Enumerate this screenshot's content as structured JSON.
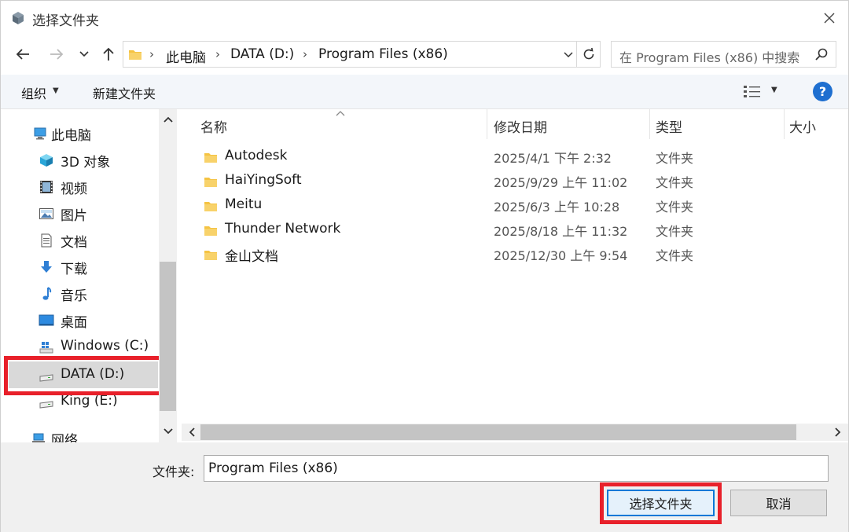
{
  "window": {
    "title": "选择文件夹"
  },
  "nav": {
    "back": "back",
    "forward": "forward",
    "recent": "recent",
    "up": "up"
  },
  "address": {
    "crumbs": [
      "此电脑",
      "DATA (D:)",
      "Program Files (x86)"
    ]
  },
  "search": {
    "placeholder": "在 Program Files (x86) 中搜索"
  },
  "toolbar": {
    "organize": "组织",
    "new_folder": "新建文件夹",
    "help": "?"
  },
  "sidebar": {
    "items": [
      {
        "label": "此电脑",
        "icon": "computer-icon"
      },
      {
        "label": "3D 对象",
        "icon": "3d-objects-icon"
      },
      {
        "label": "视频",
        "icon": "video-icon"
      },
      {
        "label": "图片",
        "icon": "pictures-icon"
      },
      {
        "label": "文档",
        "icon": "documents-icon"
      },
      {
        "label": "下载",
        "icon": "downloads-icon"
      },
      {
        "label": "音乐",
        "icon": "music-icon"
      },
      {
        "label": "桌面",
        "icon": "desktop-icon"
      },
      {
        "label": "Windows (C:)",
        "icon": "windows-drive-icon"
      },
      {
        "label": "DATA (D:)",
        "icon": "drive-icon",
        "selected": true
      },
      {
        "label": "King (E:)",
        "icon": "drive-icon"
      },
      {
        "label": "网络",
        "icon": "network-icon"
      }
    ]
  },
  "columns": {
    "name": "名称",
    "date": "修改日期",
    "type": "类型",
    "size": "大小"
  },
  "files": [
    {
      "name": "Autodesk",
      "date": "2025/4/1 下午 2:32",
      "type": "文件夹"
    },
    {
      "name": "HaiYingSoft",
      "date": "2025/9/29 上午 11:02",
      "type": "文件夹"
    },
    {
      "name": "Meitu",
      "date": "2025/6/3 上午 10:28",
      "type": "文件夹"
    },
    {
      "name": "Thunder Network",
      "date": "2025/8/18 上午 11:32",
      "type": "文件夹"
    },
    {
      "name": "金山文档",
      "date": "2025/12/30 上午 9:54",
      "type": "文件夹"
    }
  ],
  "footer": {
    "folder_label": "文件夹:",
    "folder_value": "Program Files (x86)",
    "select_button": "选择文件夹",
    "cancel_button": "取消"
  },
  "colors": {
    "highlight": "#e8202a",
    "accent": "#0078d7",
    "folder": "#f5c342"
  }
}
